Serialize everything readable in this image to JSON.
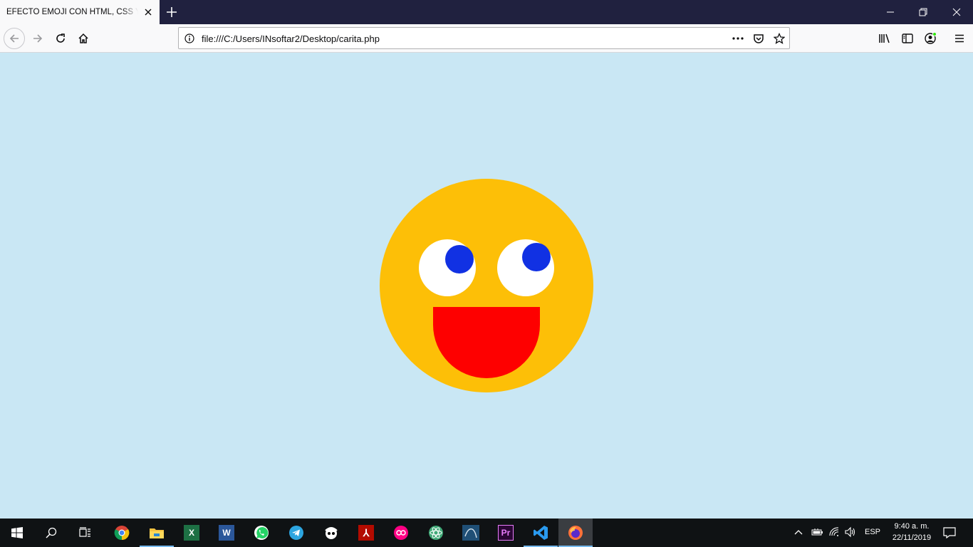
{
  "browser": {
    "tab_title": "EFECTO EMOJI CON HTML, CSS Y JAVASCRIPT",
    "url": "file:///C:/Users/INsoftar2/Desktop/carita.php"
  },
  "page": {
    "background": "#c9e7f4",
    "emoji": {
      "face_color": "#fdbf07",
      "eye_color": "#ffffff",
      "pupil_color": "#1131e3",
      "mouth_color": "#fe0000"
    }
  },
  "taskbar": {
    "apps": [
      "start-icon",
      "search-icon",
      "task-view-icon",
      "chrome-icon",
      "file-explorer-icon",
      "excel-icon",
      "word-icon",
      "whatsapp-icon",
      "telegram-icon",
      "napster-icon",
      "acrobat-icon",
      "flickr-icon",
      "atom-icon",
      "mysql-workbench-icon",
      "premiere-icon",
      "vscode-icon",
      "firefox-icon"
    ],
    "language": "ESP",
    "time": "9:40 a. m.",
    "date": "22/11/2019"
  }
}
